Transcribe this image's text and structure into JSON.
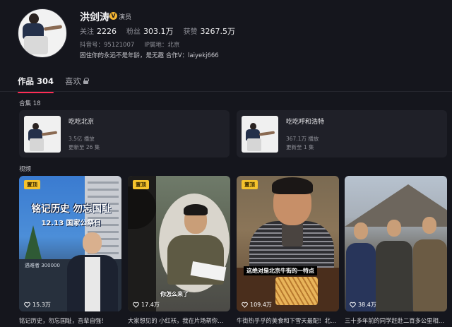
{
  "profile": {
    "name": "洪剑涛",
    "badge_icon": "v-verified-icon",
    "badge_label": "演员",
    "stats": [
      {
        "label": "关注",
        "value": "2226"
      },
      {
        "label": "粉丝",
        "value": "303.1万"
      },
      {
        "label": "获赞",
        "value": "3267.5万"
      }
    ],
    "douyin_id": "抖音号：95121007",
    "ip_location": "IP属地：北京",
    "bio": "困住你的永远不是年龄，是无趣 合作V：laiyekj666"
  },
  "tabs": [
    {
      "label": "作品 304",
      "active": true
    },
    {
      "label": "喜欢",
      "active": false,
      "icon": "lock-icon"
    }
  ],
  "collections_label": "合集 18",
  "collections": [
    {
      "title": "吃吃北京",
      "plays": "3.5亿 播放",
      "update": "更新至 26 集"
    },
    {
      "title": "吃吃呼和浩特",
      "plays": "367.1万 播放",
      "update": "更新至 1 集"
    }
  ],
  "videos_label": "视频",
  "videos": [
    {
      "pin": "置顶",
      "overlay_title": "铭记历史 勿忘国耻",
      "overlay_date": "12.13 国家公祭日",
      "overlay_wall": "遇难者 300000",
      "likes": "15.3万",
      "caption": "铭记历史，勿忘国耻，吾辈自强！"
    },
    {
      "pin": "置顶",
      "overlay_sub": "你怎么来了",
      "likes": "17.4万",
      "caption": "大家想见的 小红袄，我在片场帮你…"
    },
    {
      "pin": "置顶",
      "overlay_sub": "这绝对是北京牛街的一特点",
      "likes": "109.4万",
      "caption": "牛街热乎乎的美食和下雪天最配！北…"
    },
    {
      "likes": "38.4万",
      "caption": "三十多年前的同学赶赴二百多公里相…"
    }
  ],
  "colors": {
    "background": "#15161d",
    "card": "#1f2028",
    "accent_underline": "#fe2c55",
    "pin_badge": "#f5c32c"
  }
}
